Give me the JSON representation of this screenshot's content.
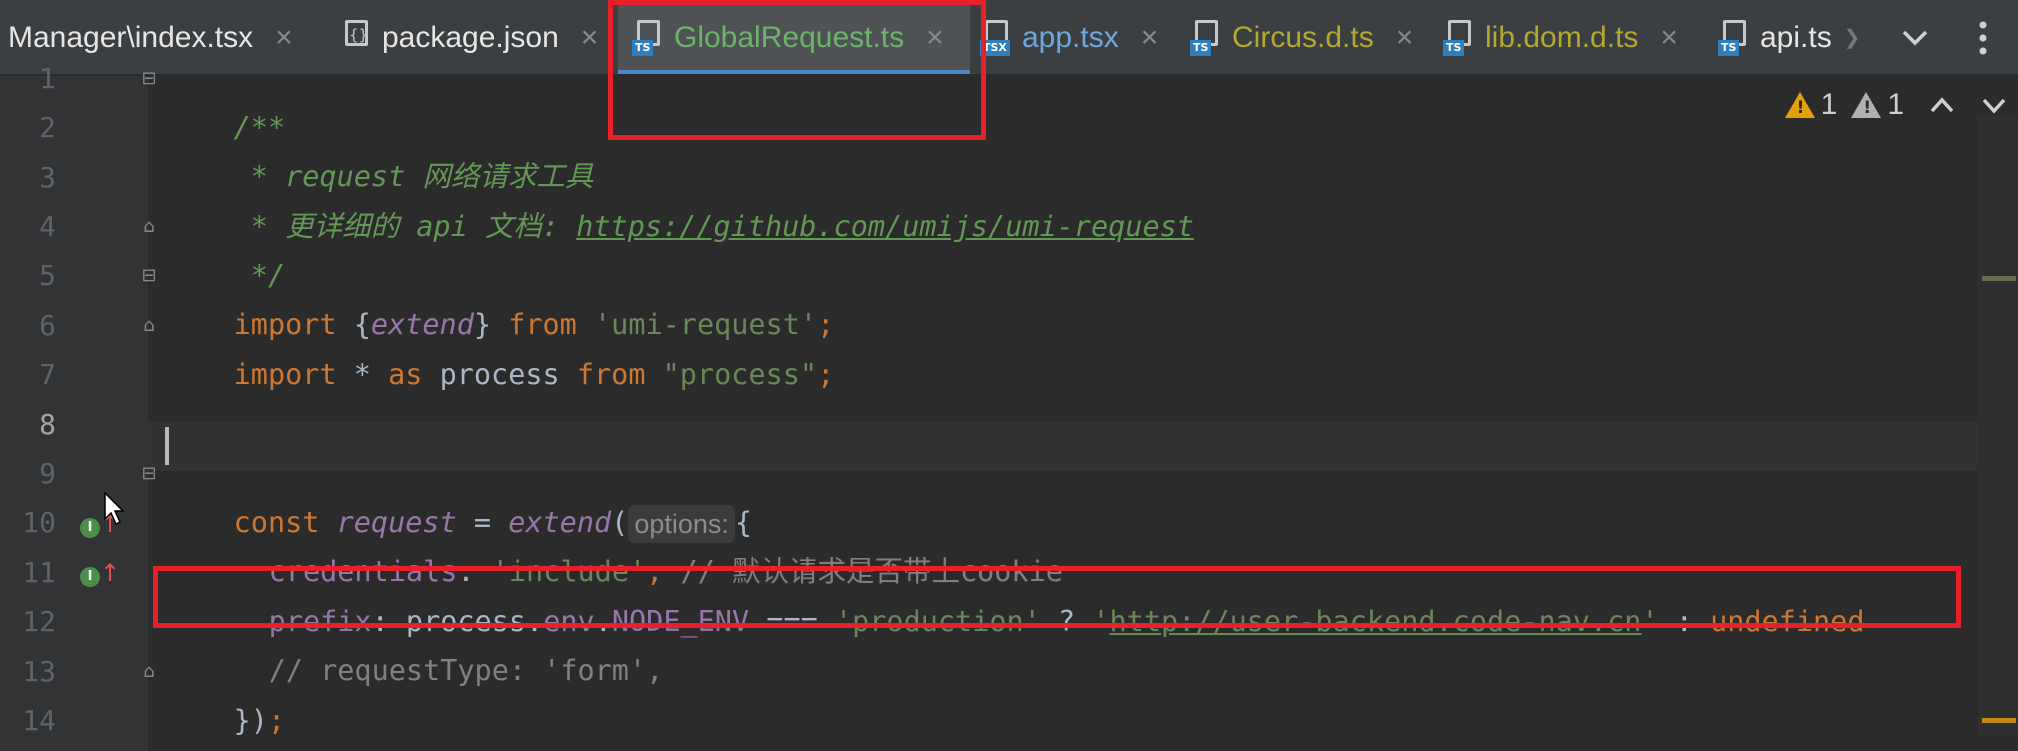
{
  "tabs": [
    {
      "label": "Manager\\index.tsx",
      "badge": "",
      "active": false
    },
    {
      "label": "package.json",
      "badge": "{}",
      "active": false
    },
    {
      "label": "GlobalRequest.ts",
      "badge": "TS",
      "active": true
    },
    {
      "label": "app.tsx",
      "badge": "TSX",
      "active": false
    },
    {
      "label": "Circus.d.ts",
      "badge": "TS",
      "active": false
    },
    {
      "label": "lib.dom.d.ts",
      "badge": "TS",
      "active": false
    },
    {
      "label": "api.ts",
      "badge": "TS",
      "active": false
    }
  ],
  "tab_colors": {
    "default": "#e6e6e6",
    "active": "#6cb36c",
    "app": "#6fa8dc",
    "lib": "#b5a82f"
  },
  "tab_close_glyph": "×",
  "tab_overflow_glyph": "❯",
  "inspections": {
    "warnings": "1",
    "weak_warnings": "1"
  },
  "line_numbers": [
    "1",
    "2",
    "3",
    "4",
    "5",
    "6",
    "7",
    "8",
    "9",
    "10",
    "11",
    "12",
    "13",
    "14"
  ],
  "current_line": "8",
  "code": {
    "l1": "/**",
    "l2": " * request 网络请求工具",
    "l3_prefix": " * 更详细的 api 文档: ",
    "l3_url": "https://github.com/umijs/umi-request",
    "l4": " */",
    "l5_import": "import ",
    "l5_brace_open": "{",
    "l5_name": "extend",
    "l5_brace_close": "}",
    "l5_from": " from ",
    "l5_str": "'umi-request'",
    "l5_semi": ";",
    "l6_import": "import ",
    "l6_star": "* ",
    "l6_as": "as ",
    "l6_name": "process ",
    "l6_from": "from ",
    "l6_str": "\"process\"",
    "l6_semi": ";",
    "l9_const": "const ",
    "l9_name": "request",
    "l9_eq": " = ",
    "l9_fn": "extend",
    "l9_paren": "(",
    "l9_hint": "options:",
    "l9_brace": "{",
    "l10_key": "credentials",
    "l10_colon": ": ",
    "l10_str": "'include'",
    "l10_comma": ", ",
    "l10_comment": "// 默认请求是否带上cookie",
    "l11_key": "prefix",
    "l11_colon": ": ",
    "l11_obj": "process",
    "l11_dot1": ".",
    "l11_env": "env",
    "l11_dot2": ".",
    "l11_node": "NODE_ENV",
    "l11_op": " === ",
    "l11_str": "'production'",
    "l11_q": " ? ",
    "l11_q1": "'",
    "l11_url": "http://user-backend.code-nav.cn",
    "l11_q2": "'",
    "l11_colon2": " : ",
    "l11_undef": "undefined",
    "l12": "// requestType: 'form',",
    "l13_close": "})",
    "l13_semi": ";"
  }
}
